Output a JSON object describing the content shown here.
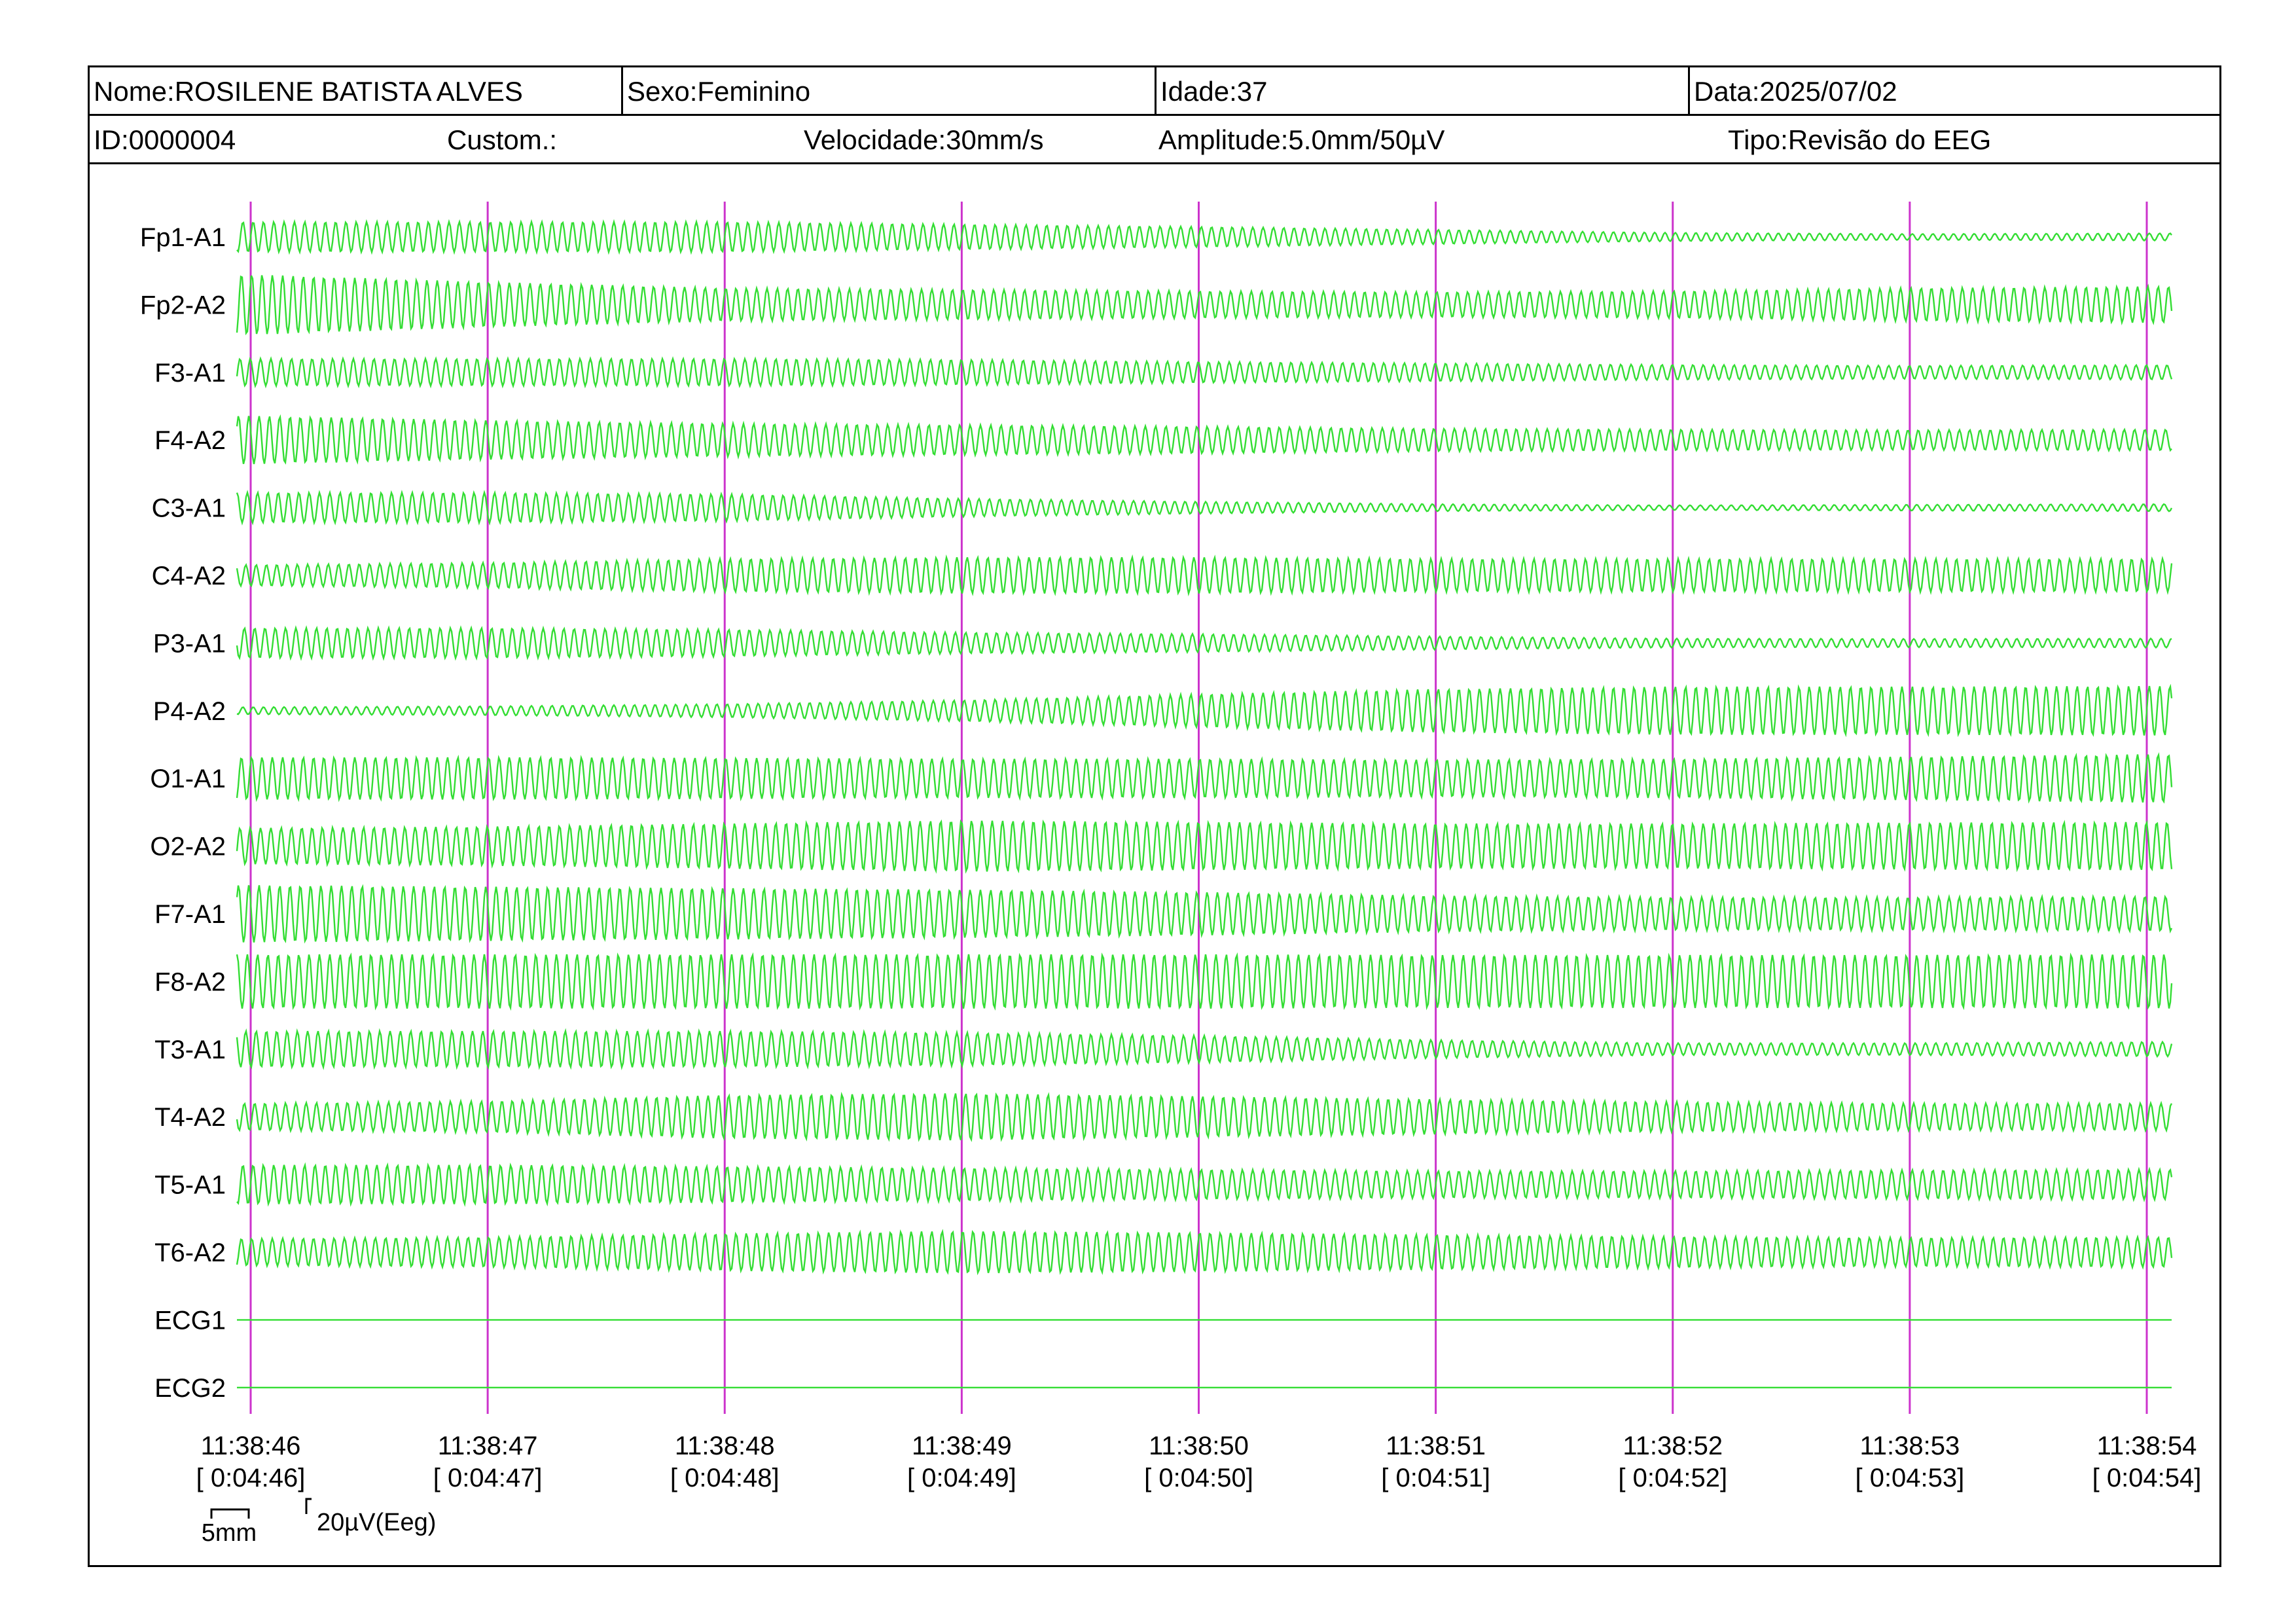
{
  "header": {
    "name": "Nome:ROSILENE BATISTA ALVES",
    "sex": "Sexo:Feminino",
    "age": "Idade:37",
    "date": "Data:2025/07/02",
    "id": "ID:0000004",
    "custom": "Custom.:",
    "speed": "Velocidade:30mm/s",
    "amplitude": "Amplitude:5.0mm/50µV",
    "type": "Tipo:Revisão do EEG"
  },
  "scale": {
    "time_label": "5mm",
    "amp_label": "20µV(Eeg)"
  },
  "colors": {
    "trace": "#33dd33",
    "time_marker": "#cc33cc",
    "text": "#000000"
  },
  "chart_data": {
    "type": "line",
    "title": "",
    "x_ticks": [
      {
        "time": "11:38:46",
        "elapsed": "[ 0:04:46]"
      },
      {
        "time": "11:38:47",
        "elapsed": "[ 0:04:47]"
      },
      {
        "time": "11:38:48",
        "elapsed": "[ 0:04:48]"
      },
      {
        "time": "11:38:49",
        "elapsed": "[ 0:04:49]"
      },
      {
        "time": "11:38:50",
        "elapsed": "[ 0:04:50]"
      },
      {
        "time": "11:38:51",
        "elapsed": "[ 0:04:51]"
      },
      {
        "time": "11:38:52",
        "elapsed": "[ 0:04:52]"
      },
      {
        "time": "11:38:53",
        "elapsed": "[ 0:04:53]"
      },
      {
        "time": "11:38:54",
        "elapsed": "[ 0:04:54]"
      }
    ],
    "channels": [
      {
        "name": "Fp1-A1",
        "amp": [
          0.5,
          0.5,
          0.5,
          0.42,
          0.34,
          0.24,
          0.14,
          0.1,
          0.12
        ]
      },
      {
        "name": "Fp2-A2",
        "amp": [
          1.0,
          0.75,
          0.55,
          0.5,
          0.45,
          0.42,
          0.45,
          0.55,
          0.6
        ]
      },
      {
        "name": "F3-A1",
        "amp": [
          0.45,
          0.45,
          0.45,
          0.42,
          0.35,
          0.3,
          0.25,
          0.22,
          0.24
        ]
      },
      {
        "name": "F4-A2",
        "amp": [
          0.8,
          0.65,
          0.55,
          0.5,
          0.45,
          0.38,
          0.35,
          0.33,
          0.35
        ]
      },
      {
        "name": "C3-A1",
        "amp": [
          0.5,
          0.5,
          0.45,
          0.3,
          0.2,
          0.12,
          0.08,
          0.1,
          0.12
        ]
      },
      {
        "name": "C4-A2",
        "amp": [
          0.35,
          0.42,
          0.55,
          0.6,
          0.6,
          0.55,
          0.55,
          0.55,
          0.55
        ]
      },
      {
        "name": "P3-A1",
        "amp": [
          0.5,
          0.5,
          0.45,
          0.35,
          0.3,
          0.22,
          0.15,
          0.14,
          0.15
        ]
      },
      {
        "name": "P4-A2",
        "amp": [
          0.12,
          0.15,
          0.22,
          0.35,
          0.55,
          0.72,
          0.8,
          0.8,
          0.82
        ]
      },
      {
        "name": "O1-A1",
        "amp": [
          0.7,
          0.7,
          0.68,
          0.65,
          0.65,
          0.62,
          0.65,
          0.72,
          0.8
        ]
      },
      {
        "name": "O2-A2",
        "amp": [
          0.6,
          0.65,
          0.75,
          0.85,
          0.8,
          0.75,
          0.75,
          0.78,
          0.8
        ]
      },
      {
        "name": "F7-A1",
        "amp": [
          0.95,
          0.9,
          0.85,
          0.8,
          0.72,
          0.6,
          0.55,
          0.55,
          0.58
        ]
      },
      {
        "name": "F8-A2",
        "amp": [
          0.9,
          0.9,
          0.9,
          0.9,
          0.9,
          0.88,
          0.88,
          0.88,
          0.9
        ]
      },
      {
        "name": "T3-A1",
        "amp": [
          0.6,
          0.6,
          0.6,
          0.55,
          0.45,
          0.3,
          0.2,
          0.2,
          0.24
        ]
      },
      {
        "name": "T4-A2",
        "amp": [
          0.45,
          0.52,
          0.72,
          0.78,
          0.68,
          0.58,
          0.5,
          0.45,
          0.45
        ]
      },
      {
        "name": "T5-A1",
        "amp": [
          0.65,
          0.65,
          0.6,
          0.55,
          0.5,
          0.45,
          0.45,
          0.48,
          0.5
        ]
      },
      {
        "name": "T6-A2",
        "amp": [
          0.45,
          0.5,
          0.62,
          0.7,
          0.65,
          0.58,
          0.52,
          0.48,
          0.5
        ]
      },
      {
        "name": "ECG1",
        "amp": [
          0,
          0,
          0,
          0,
          0,
          0,
          0,
          0,
          0
        ]
      },
      {
        "name": "ECG2",
        "amp": [
          0,
          0,
          0,
          0,
          0,
          0,
          0,
          0,
          0
        ]
      }
    ],
    "cycles_per_second": 23,
    "grid": false
  }
}
